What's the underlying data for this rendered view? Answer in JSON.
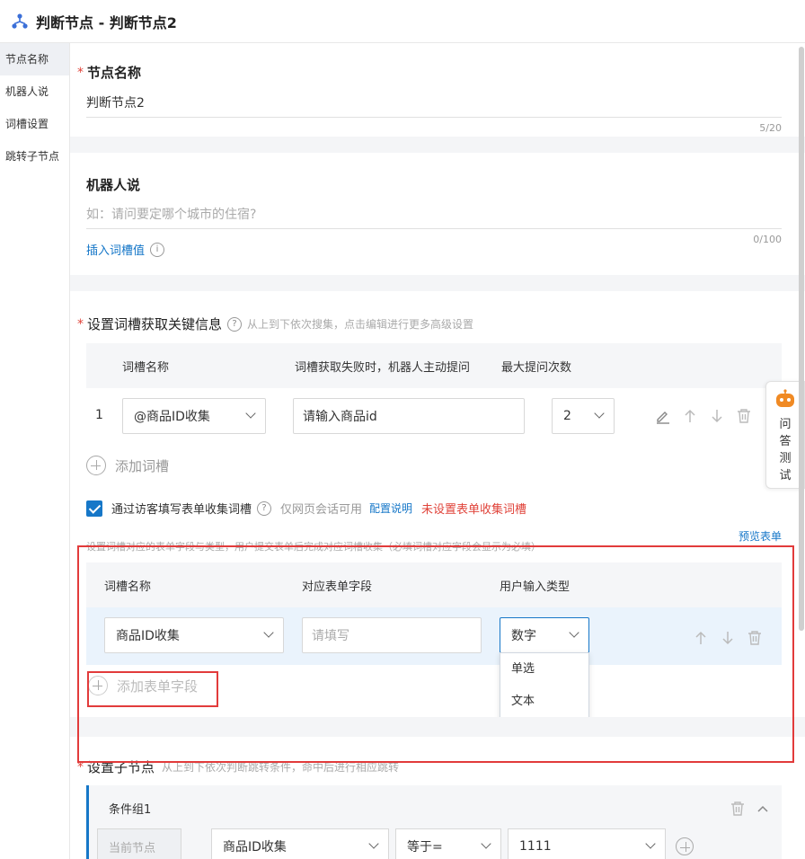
{
  "header": {
    "title": "判断节点 - 判断节点2"
  },
  "sidebar": {
    "items": [
      {
        "label": "节点名称",
        "active": true
      },
      {
        "label": "机器人说",
        "active": false
      },
      {
        "label": "词槽设置",
        "active": false
      },
      {
        "label": "跳转子节点",
        "active": false
      }
    ]
  },
  "node_name": {
    "required_mark": "*",
    "label": "节点名称",
    "value": "判断节点2",
    "counter": "5/20"
  },
  "robot_say": {
    "label": "机器人说",
    "placeholder": "如：请问要定哪个城市的住宿?",
    "counter": "0/100",
    "insert_link": "插入词槽值"
  },
  "slots": {
    "required_mark": "*",
    "title": "设置词槽获取关键信息",
    "hint": "从上到下依次搜集，点击编辑进行更多高级设置",
    "columns": {
      "name": "词槽名称",
      "prompt": "词槽获取失败时，机器人主动提问",
      "max": "最大提问次数"
    },
    "rows": [
      {
        "index": "1",
        "name": "@商品ID收集",
        "prompt": "请输入商品id",
        "max": "2"
      }
    ],
    "add_label": "添加词槽"
  },
  "form_collect": {
    "checkbox_label": "通过访客填写表单收集词槽",
    "web_only": "仅网页会话可用",
    "config_link": "配置说明",
    "warning": "未设置表单收集词槽",
    "hint": "设置词槽对应的表单字段与类型，用户提交表单后完成对应词槽收集（必填词槽对应字段会显示为必填）",
    "preview_link": "预览表单",
    "columns": {
      "slot": "词槽名称",
      "field": "对应表单字段",
      "type": "用户输入类型"
    },
    "rows": [
      {
        "slot": "商品ID收集",
        "field_placeholder": "请填写",
        "type": "数字"
      }
    ],
    "add_label": "添加表单字段",
    "type_options": [
      "单选",
      "文本",
      "数字"
    ],
    "selected_option": "数字"
  },
  "child_nodes": {
    "required_mark": "*",
    "title": "设置子节点",
    "hint": "从上到下依次判断跳转条件，命中后进行相应跳转",
    "group_title": "条件组1",
    "condition": {
      "source": "当前节点",
      "slot": "商品ID收集",
      "op": "等于=",
      "value": "1111"
    }
  },
  "float_widget": {
    "chars": [
      "问",
      "答",
      "测",
      "试"
    ]
  },
  "colors": {
    "accent": "#1677c8",
    "warning": "#e0433a",
    "highlight_box": "#e23b3b"
  }
}
